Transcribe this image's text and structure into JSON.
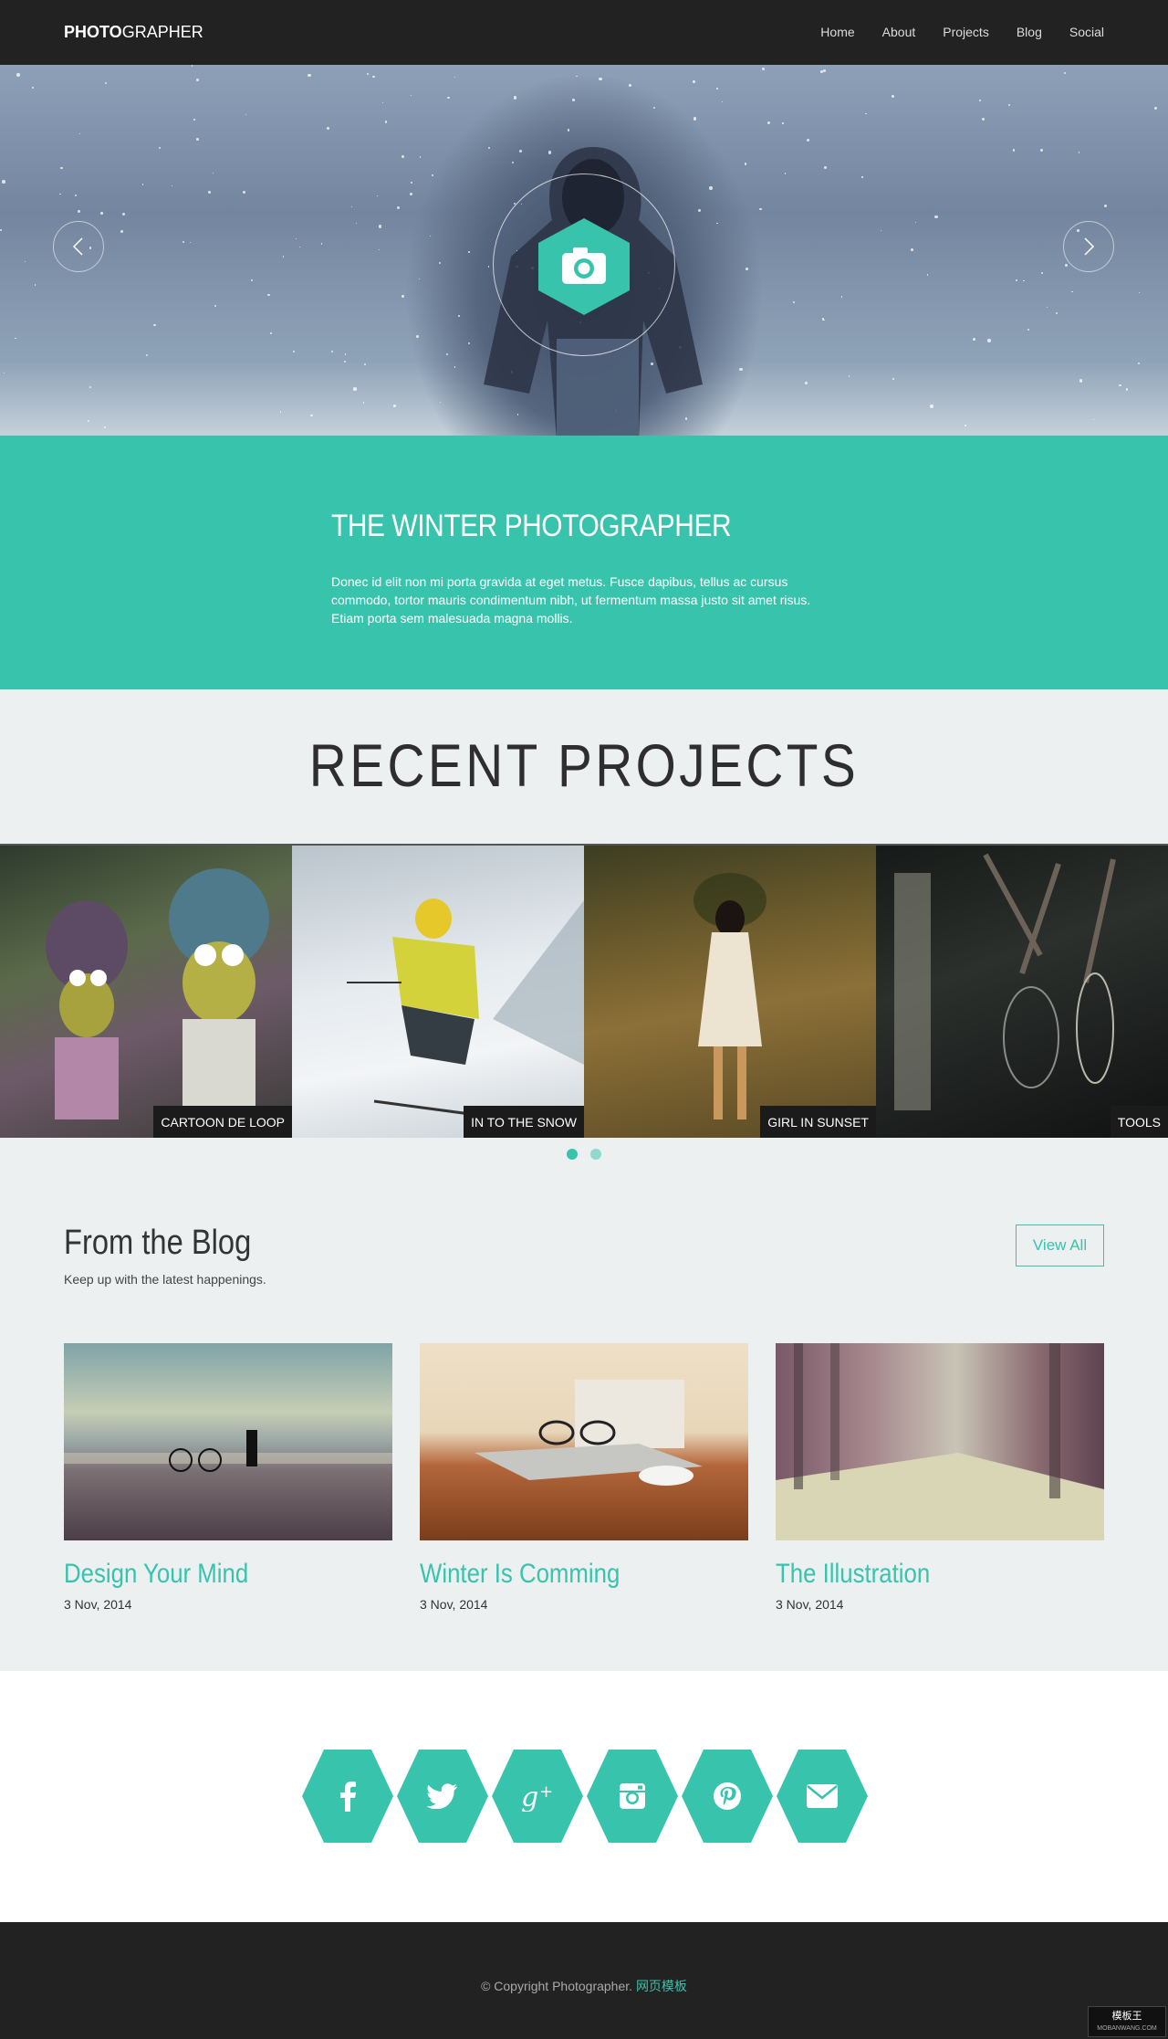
{
  "nav": {
    "logo_bold": "PHOTO",
    "logo_light": "GRAPHER",
    "items": [
      {
        "label": "Home"
      },
      {
        "label": "About"
      },
      {
        "label": "Projects"
      },
      {
        "label": "Blog"
      },
      {
        "label": "Social"
      }
    ]
  },
  "hero": {
    "center_icon": "camera-icon",
    "prev_icon": "chevron-left-icon",
    "next_icon": "chevron-right-icon"
  },
  "intro": {
    "title": "THE WINTER PHOTOGRAPHER",
    "text": "Donec id elit non mi porta gravida at eget metus. Fusce dapibus, tellus ac cursus commodo, tortor mauris condimentum nibh, ut fermentum massa justo sit amet risus. Etiam porta sem malesuada magna mollis."
  },
  "projects": {
    "title": "RECENT PROJECTS",
    "items": [
      {
        "caption": "CARTOON DE LOOP"
      },
      {
        "caption": "IN TO THE SNOW"
      },
      {
        "caption": "GIRL IN SUNSET"
      },
      {
        "caption": "TOOLS"
      }
    ],
    "pagination": {
      "pages": 2,
      "active": 1
    }
  },
  "blog": {
    "title": "From the Blog",
    "subtitle": "Keep up with the latest happenings.",
    "view_all": "View All",
    "posts": [
      {
        "title": "Design Your Mind",
        "date": "3 Nov, 2014"
      },
      {
        "title": "Winter Is Comming",
        "date": "3 Nov, 2014"
      },
      {
        "title": "The Illustration",
        "date": "3 Nov, 2014"
      }
    ]
  },
  "social": {
    "icons": [
      "facebook-icon",
      "twitter-icon",
      "google-plus-icon",
      "instagram-icon",
      "pinterest-icon",
      "email-icon"
    ]
  },
  "footer": {
    "copyright": "© Copyright Photographer.",
    "link": "网页模板",
    "badge_main": "模板王",
    "badge_sub": "MOBANWANG.COM"
  },
  "colors": {
    "accent": "#37c3ac",
    "dark": "#222222",
    "light_bg": "#ecf0f1"
  }
}
